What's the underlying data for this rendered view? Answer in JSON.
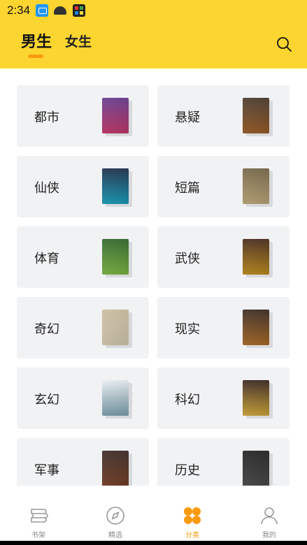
{
  "status_bar": {
    "time": "2:34",
    "icons": [
      "tv-app-icon",
      "android-icon",
      "app-grid-icon"
    ]
  },
  "header": {
    "tabs": [
      {
        "label": "男生",
        "active": true
      },
      {
        "label": "女生",
        "active": false
      }
    ],
    "accent_color": "#FDD530",
    "active_underline_color": "#F89A0E",
    "search_icon": "search-icon"
  },
  "categories": [
    {
      "label": "都市",
      "cover_colors": [
        "#5b2a86",
        "#e0407a"
      ]
    },
    {
      "label": "悬疑",
      "cover_colors": [
        "#3a2a1e",
        "#b06a2c"
      ]
    },
    {
      "label": "仙侠",
      "cover_colors": [
        "#0b1d3a",
        "#1fb6d9"
      ]
    },
    {
      "label": "短篇",
      "cover_colors": [
        "#6b5a3a",
        "#d8c08a"
      ]
    },
    {
      "label": "体育",
      "cover_colors": [
        "#1f5a1a",
        "#8fd14f"
      ]
    },
    {
      "label": "武侠",
      "cover_colors": [
        "#3a1a0a",
        "#d9a020"
      ]
    },
    {
      "label": "奇幻",
      "cover_colors": [
        "#c7b89a",
        "#f3e7c8"
      ]
    },
    {
      "label": "现实",
      "cover_colors": [
        "#2a1a12",
        "#c47a2c"
      ]
    },
    {
      "label": "玄幻",
      "cover_colors": [
        "#e8eef2",
        "#8fb8c8"
      ]
    },
    {
      "label": "科幻",
      "cover_colors": [
        "#2a1410",
        "#f0c040"
      ]
    },
    {
      "label": "军事",
      "cover_colors": [
        "#2a1a14",
        "#8a4a30"
      ]
    },
    {
      "label": "历史",
      "cover_colors": [
        "#111111",
        "#555555"
      ]
    }
  ],
  "bottom_nav": [
    {
      "label": "书架",
      "icon": "bookshelf-icon",
      "active": false
    },
    {
      "label": "精选",
      "icon": "compass-icon",
      "active": false
    },
    {
      "label": "分类",
      "icon": "category-grid-icon",
      "active": true
    },
    {
      "label": "我的",
      "icon": "profile-icon",
      "active": false
    }
  ],
  "nav_active_color": "#F89A0E"
}
